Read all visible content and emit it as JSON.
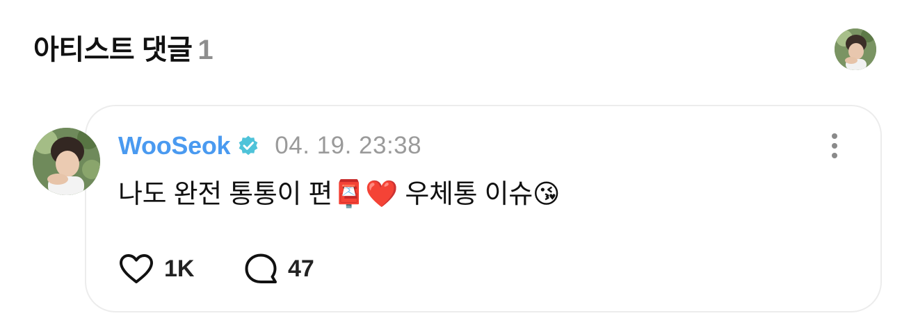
{
  "header": {
    "title": "아티스트 댓글",
    "count": "1",
    "avatar_icon": "profile-avatar"
  },
  "comment": {
    "author": "WooSeok",
    "verified_icon": "verified-badge-icon",
    "timestamp": "04. 19. 23:38",
    "text": "나도 완전 통통이 편📮❤️ 우체통 이슈😘",
    "like_count": "1K",
    "reply_count": "47",
    "more_icon": "more-vertical-icon"
  },
  "colors": {
    "author": "#4a9af0",
    "verified": "#4fc3d9",
    "muted": "#9a9a9a",
    "card_border": "#ececec"
  }
}
